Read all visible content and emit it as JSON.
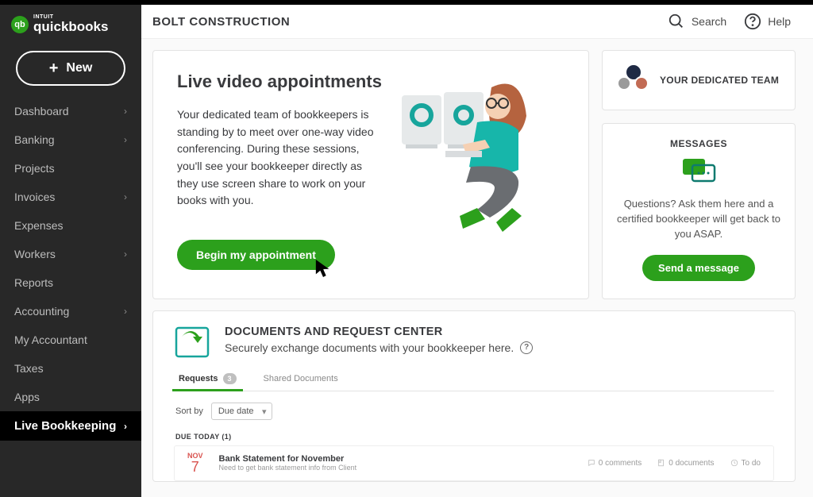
{
  "brand": {
    "super": "INTUIT",
    "name": "quickbooks",
    "badge": "qb"
  },
  "sidebar": {
    "new_label": "New",
    "items": [
      {
        "label": "Dashboard",
        "exp": true
      },
      {
        "label": "Banking",
        "exp": true
      },
      {
        "label": "Projects",
        "exp": false
      },
      {
        "label": "Invoices",
        "exp": true
      },
      {
        "label": "Expenses",
        "exp": false
      },
      {
        "label": "Workers",
        "exp": true
      },
      {
        "label": "Reports",
        "exp": false
      },
      {
        "label": "Accounting",
        "exp": true
      },
      {
        "label": "My Accountant",
        "exp": false
      },
      {
        "label": "Taxes",
        "exp": false
      },
      {
        "label": "Apps",
        "exp": false
      }
    ],
    "active": {
      "label": "Live Bookkeeping"
    }
  },
  "header": {
    "company": "BOLT CONSTRUCTION",
    "search_label": "Search",
    "help_label": "Help"
  },
  "appointment": {
    "title": "Live video appointments",
    "desc": "Your dedicated team of bookkeepers is standing by to meet over one-way video conferencing. During these sessions, you'll see your bookkeeper directly as they use screen share to work on your books with you.",
    "cta": "Begin my appointment"
  },
  "team": {
    "title": "YOUR DEDICATED TEAM"
  },
  "messages": {
    "title": "MESSAGES",
    "desc": "Questions? Ask them here and a certified bookkeeper will get back to you ASAP.",
    "cta": "Send a message"
  },
  "documents": {
    "title": "DOCUMENTS AND REQUEST CENTER",
    "subtitle": "Securely exchange documents with your bookkeeper here.",
    "tabs": [
      {
        "label": "Requests",
        "count": "3"
      },
      {
        "label": "Shared Documents"
      }
    ],
    "sort_label": "Sort by",
    "sort_value": "Due date",
    "due_header": "DUE TODAY (1)",
    "request": {
      "month": "NOV",
      "day": "7",
      "title": "Bank Statement for November",
      "subtitle": "Need to get bank statement info from Client",
      "comments": "0  comments",
      "docs": "0  documents",
      "status": "To do"
    }
  }
}
